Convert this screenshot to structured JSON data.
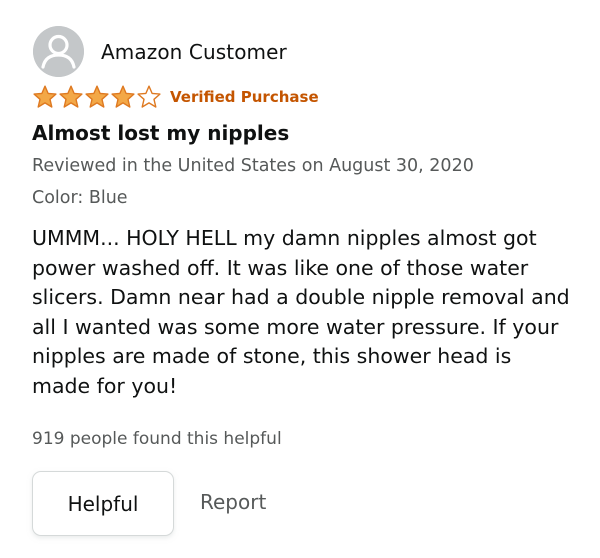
{
  "review": {
    "reviewer_name": "Amazon Customer",
    "rating": 4,
    "rating_max": 5,
    "verified_label": "Verified Purchase",
    "title": "Almost lost my nipples",
    "date_text": "Reviewed in the United States on August 30, 2020",
    "variant_text": "Color: Blue",
    "body": "UMMM... HOLY HELL my damn nipples almost got power washed off. It was like one of those water slicers. Damn near had a double nipple removal and all I wanted was some more water pressure. If your nipples are made of stone, this shower head is made for you!",
    "helpful_count_text": "919 people found this helpful",
    "helpful_button_label": "Helpful",
    "report_label": "Report"
  },
  "colors": {
    "star_fill": "#f3a847",
    "star_stroke": "#de7921",
    "verified": "#c45500",
    "secondary_text": "#565959",
    "avatar_bg": "#c4c7c9"
  },
  "icons": {
    "avatar": "default-user-avatar-icon",
    "star_full": "star-filled-icon",
    "star_empty": "star-outline-icon"
  }
}
